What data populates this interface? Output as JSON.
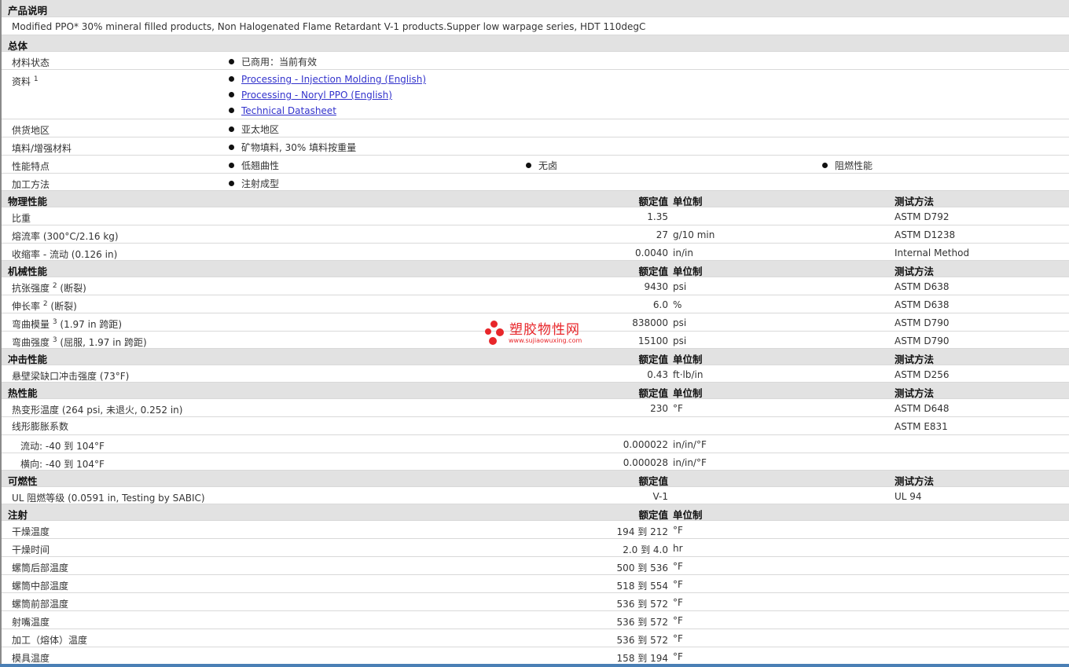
{
  "sections": {
    "description": "产品说明",
    "general": "总体",
    "physical": "物理性能",
    "mechanical": "机械性能",
    "impact": "冲击性能",
    "thermal": "热性能",
    "flammability": "可燃性",
    "injection": "注射"
  },
  "headers": {
    "nominal": "额定值",
    "unit": "单位制",
    "method": "测试方法"
  },
  "description_text": "Modified PPO* 30% mineral filled products, Non Halogenated Flame Retardant V-1 products.Supper low warpage series, HDT 110degC",
  "general": {
    "status_label": "材料状态",
    "status_value": "已商用：当前有效",
    "docs_label": "资料",
    "docs_sup": "1",
    "docs": [
      "Processing - Injection Molding (English)",
      "Processing - Noryl PPO (English)",
      "Technical Datasheet"
    ],
    "region_label": "供货地区",
    "region_value": "亚太地区",
    "filler_label": "填料/增强材料",
    "filler_value": "矿物填料, 30% 填料按重量",
    "features_label": "性能特点",
    "features": [
      "低翘曲性",
      "无卤",
      "阻燃性能"
    ],
    "process_label": "加工方法",
    "process_value": "注射成型"
  },
  "physical": {
    "rows": [
      {
        "label": "比重",
        "value": "1.35",
        "unit": "",
        "method": "ASTM D792"
      },
      {
        "label": "熔流率 (300°C/2.16 kg)",
        "value": "27",
        "unit": "g/10 min",
        "method": "ASTM D1238"
      },
      {
        "label": "收缩率 - 流动 (0.126 in)",
        "value": "0.0040",
        "unit": "in/in",
        "method": "Internal Method"
      }
    ]
  },
  "mechanical": {
    "rows": [
      {
        "label_a": "抗张强度",
        "sup": "2",
        "label_b": "(断裂)",
        "value": "9430",
        "unit": "psi",
        "method": "ASTM D638"
      },
      {
        "label_a": "伸长率",
        "sup": "2",
        "label_b": "(断裂)",
        "value": "6.0",
        "unit": "%",
        "method": "ASTM D638"
      },
      {
        "label_a": "弯曲模量",
        "sup": "3",
        "label_b": "(1.97 in 跨距)",
        "value": "838000",
        "unit": "psi",
        "method": "ASTM D790"
      },
      {
        "label_a": "弯曲强度",
        "sup": "3",
        "label_b": "(屈服, 1.97 in 跨距)",
        "value": "15100",
        "unit": "psi",
        "method": "ASTM D790"
      }
    ]
  },
  "impact": {
    "rows": [
      {
        "label": "悬壁梁缺口冲击强度 (73°F)",
        "value": "0.43",
        "unit": "ft·lb/in",
        "method": "ASTM D256"
      }
    ]
  },
  "thermal": {
    "hdt": {
      "label": "热变形温度 (264 psi, 未退火, 0.252 in)",
      "value": "230",
      "unit": "°F",
      "method": "ASTM D648"
    },
    "clte": {
      "label": "线形膨胀系数",
      "method": "ASTM E831"
    },
    "flow": {
      "label": "流动: -40 到  104°F",
      "value": "0.000022",
      "unit": "in/in/°F"
    },
    "transverse": {
      "label": "横向: -40 到  104°F",
      "value": "0.000028",
      "unit": "in/in/°F"
    }
  },
  "flammability": {
    "rows": [
      {
        "label": "UL 阻燃等级 (0.0591 in, Testing by SABIC)",
        "value": "V-1",
        "method": "UL 94"
      }
    ]
  },
  "injection": {
    "rows": [
      {
        "label": "干燥温度",
        "value": "194 到  212",
        "unit": "°F"
      },
      {
        "label": "干燥时间",
        "value": "2.0 到  4.0",
        "unit": "hr"
      },
      {
        "label": "螺筒后部温度",
        "value": "500 到  536",
        "unit": "°F"
      },
      {
        "label": "螺筒中部温度",
        "value": "518 到  554",
        "unit": "°F"
      },
      {
        "label": "螺筒前部温度",
        "value": "536 到  572",
        "unit": "°F"
      },
      {
        "label": "射嘴温度",
        "value": "536 到  572",
        "unit": "°F"
      },
      {
        "label": "加工（熔体）温度",
        "value": "536 到  572",
        "unit": "°F"
      },
      {
        "label": "模具温度",
        "value": "158 到  194",
        "unit": "°F"
      }
    ]
  },
  "watermark": {
    "name": "塑胶物性网",
    "url": "www.sujiaowuxing.com"
  }
}
